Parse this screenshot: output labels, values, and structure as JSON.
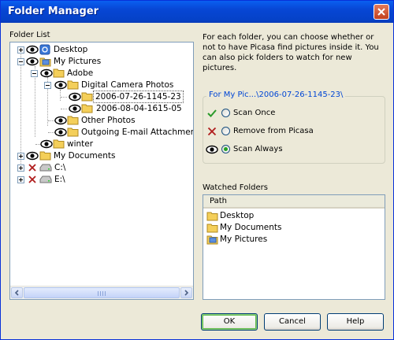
{
  "window": {
    "title": "Folder Manager"
  },
  "folder_list": {
    "label": "Folder List",
    "tree": [
      {
        "label": "Desktop",
        "status": "eye",
        "icon": "desktop-icon"
      },
      {
        "label": "My Pictures",
        "status": "eye",
        "icon": "pictures-folder-icon"
      },
      {
        "label": "Adobe",
        "status": "eye",
        "icon": "folder-icon"
      },
      {
        "label": "Digital Camera Photos",
        "status": "eye",
        "icon": "folder-icon"
      },
      {
        "label": "2006-07-26-1145-23",
        "status": "eye",
        "icon": "folder-icon",
        "selected": true
      },
      {
        "label": "2006-08-04-1615-05",
        "status": "eye",
        "icon": "folder-icon"
      },
      {
        "label": "Other Photos",
        "status": "eye",
        "icon": "folder-icon"
      },
      {
        "label": "Outgoing E-mail Attachment",
        "status": "eye",
        "icon": "folder-icon"
      },
      {
        "label": "winter",
        "status": "eye",
        "icon": "folder-icon"
      },
      {
        "label": "My Documents",
        "status": "eye",
        "icon": "folder-icon"
      },
      {
        "label": "C:\\",
        "status": "x",
        "icon": "drive-icon"
      },
      {
        "label": "E:\\",
        "status": "x",
        "icon": "drive-icon"
      }
    ]
  },
  "info_text": "For each folder, you can choose whether or not to have Picasa find pictures inside it.  You can also pick folders to watch for new pictures.",
  "options": {
    "group_label": "For My Pic...\\2006-07-26-1145-23\\",
    "items": [
      {
        "label": "Scan Once",
        "icon": "checkmark-icon",
        "selected": false
      },
      {
        "label": "Remove from Picasa",
        "icon": "x-mark-icon",
        "selected": false
      },
      {
        "label": "Scan Always",
        "icon": "eye-icon",
        "selected": true
      }
    ]
  },
  "watched": {
    "label": "Watched Folders",
    "column": "Path",
    "items": [
      {
        "label": "Desktop",
        "icon": "folder-icon"
      },
      {
        "label": "My Documents",
        "icon": "folder-icon"
      },
      {
        "label": "My Pictures",
        "icon": "pictures-folder-icon"
      }
    ]
  },
  "buttons": {
    "ok": "OK",
    "cancel": "Cancel",
    "help": "Help"
  },
  "colors": {
    "title_bar": "#0a5ff0",
    "group_label": "#0046d5",
    "scan_always_radio": "#21a121",
    "remove_x": "#b01c1c",
    "scan_once_check": "#2a9a2a"
  }
}
